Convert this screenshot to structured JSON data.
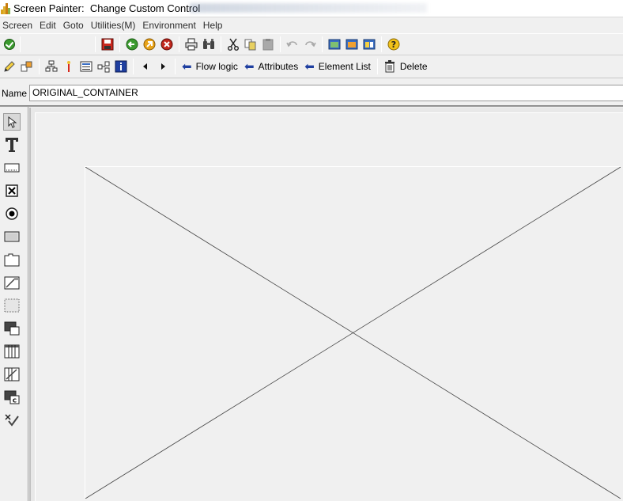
{
  "window": {
    "title": "Screen Painter:  Change Custom Control"
  },
  "menu": {
    "items": [
      "Screen",
      "Edit",
      "Goto",
      "Utilities(M)",
      "Environment",
      "Help"
    ]
  },
  "toolbar2": {
    "flow_logic": "Flow logic",
    "attributes": "Attributes",
    "element_list": "Element List",
    "delete": "Delete"
  },
  "name_field": {
    "label": "Name",
    "value": "ORIGINAL_CONTAINER"
  },
  "palette": {
    "items": [
      "select-pointer",
      "text-field",
      "entry-field",
      "checkbox",
      "radio-button",
      "pushbutton",
      "tabstrip",
      "tabstrip-wizard",
      "box",
      "subscreen-area",
      "table-control",
      "table-control-wizard",
      "custom-control",
      "status-icon"
    ]
  },
  "colors": {
    "accent_blue": "#1f3fa0",
    "ok_green": "#3a9a2e",
    "cancel_red": "#c0281e"
  }
}
